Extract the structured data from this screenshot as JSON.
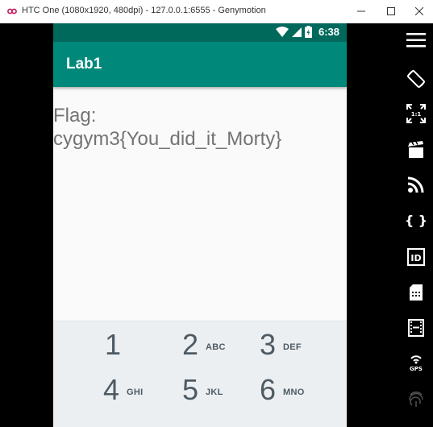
{
  "window": {
    "title": "HTC One (1080x1920, 480dpi) - 127.0.0.1:6555 - Genymotion"
  },
  "status_bar": {
    "time": "6:38",
    "icons": [
      "wifi-icon",
      "signal-icon",
      "battery-icon"
    ]
  },
  "app_bar": {
    "title": "Lab1"
  },
  "content": {
    "flag_label": "Flag:",
    "flag_value": "cygym3{You_did_it_Morty}"
  },
  "dialpad": {
    "keys": [
      {
        "digit": "1",
        "letters": ""
      },
      {
        "digit": "2",
        "letters": "ABC"
      },
      {
        "digit": "3",
        "letters": "DEF"
      },
      {
        "digit": "4",
        "letters": "GHI"
      },
      {
        "digit": "5",
        "letters": "JKL"
      },
      {
        "digit": "6",
        "letters": "MNO"
      }
    ]
  },
  "toolbar": {
    "items": [
      "menu-icon",
      "rotate-icon",
      "pixel-perfect-icon",
      "camera-icon",
      "remote-control-icon",
      "open-gapps-icon",
      "identifiers-icon",
      "sms-icon",
      "media-icon",
      "gps-icon",
      "fingerprint-icon"
    ],
    "gps_label": "GPS",
    "pixel_label": "1:1",
    "id_label": "ID",
    "braces_label": "{ }"
  },
  "colors": {
    "status_bar": "#00695c",
    "app_bar": "#00897b",
    "background": "#fafafa",
    "dialpad": "#eceff1"
  }
}
